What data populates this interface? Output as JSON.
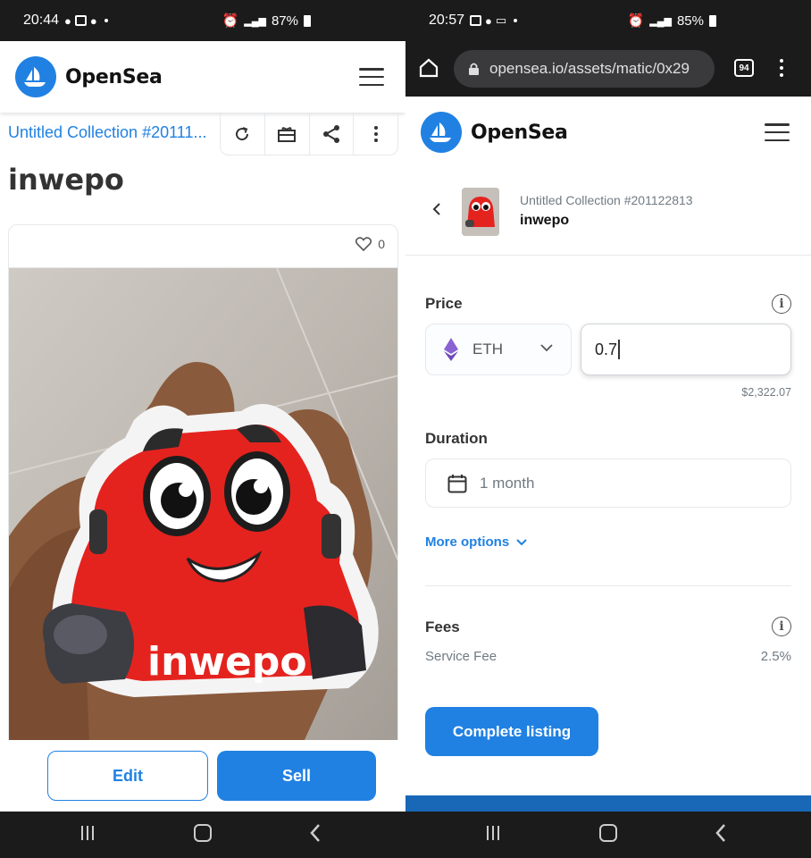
{
  "left": {
    "status": {
      "time": "20:44",
      "battery": "87%"
    },
    "header": {
      "brand": "OpenSea"
    },
    "breadcrumb": "Untitled Collection #20111...",
    "title": "inwepo",
    "likes": "0",
    "sticker_text": "inwepo",
    "buttons": {
      "edit": "Edit",
      "sell": "Sell"
    }
  },
  "right": {
    "status": {
      "time": "20:57",
      "battery": "85%"
    },
    "browser": {
      "url": "opensea.io/assets/matic/0x29",
      "tab_count": "94"
    },
    "header": {
      "brand": "OpenSea"
    },
    "listing": {
      "collection": "Untitled Collection #201122813",
      "name": "inwepo"
    },
    "price": {
      "label": "Price",
      "currency": "ETH",
      "value": "0.7",
      "usd": "$2,322.07"
    },
    "duration": {
      "label": "Duration",
      "value": "1 month"
    },
    "more_options": "More options",
    "fees": {
      "label": "Fees",
      "service_fee_label": "Service Fee",
      "service_fee_value": "2.5%"
    },
    "complete_button": "Complete listing"
  },
  "colors": {
    "accent": "#2081E2",
    "mascot_red": "#E4231F"
  }
}
